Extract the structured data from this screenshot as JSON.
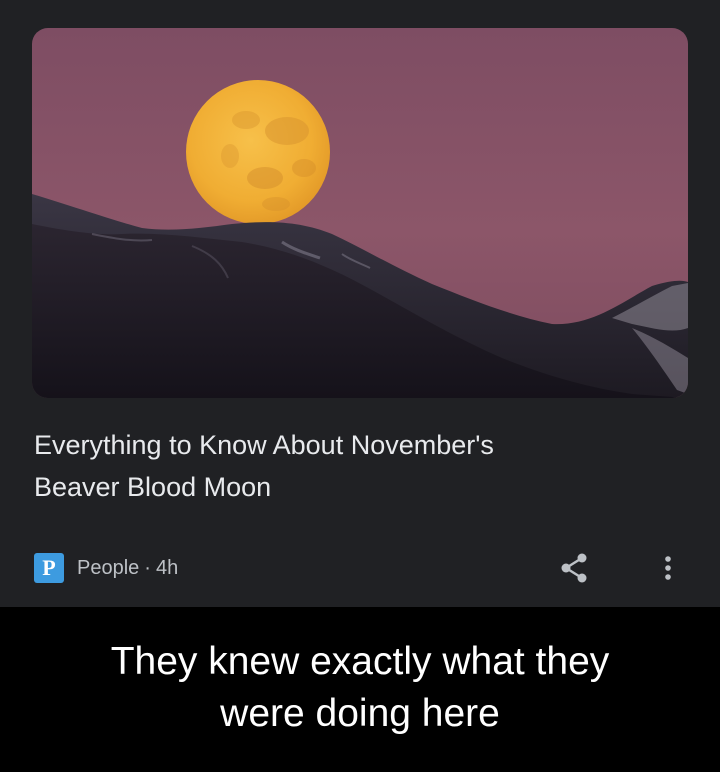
{
  "article": {
    "headline_line1": "Everything to Know About November's",
    "headline_line2": "Beaver Blood Moon",
    "publisher_logo_letter": "P",
    "publisher": "People",
    "separator": "·",
    "age": "4h",
    "hero_image_icon": "full-moon-over-mountains-image",
    "share_icon": "share-icon",
    "more_icon": "more-vert-icon"
  },
  "caption": {
    "line1": "They knew exactly what they",
    "line2": "were doing here"
  },
  "colors": {
    "card_background": "#202124",
    "page_background": "#000000",
    "sky": "#8a5468",
    "moon": "#f0b43c",
    "publisher_logo": "#3d9be0",
    "headline_text": "#e8eaed",
    "meta_text": "#bdc1c6"
  }
}
